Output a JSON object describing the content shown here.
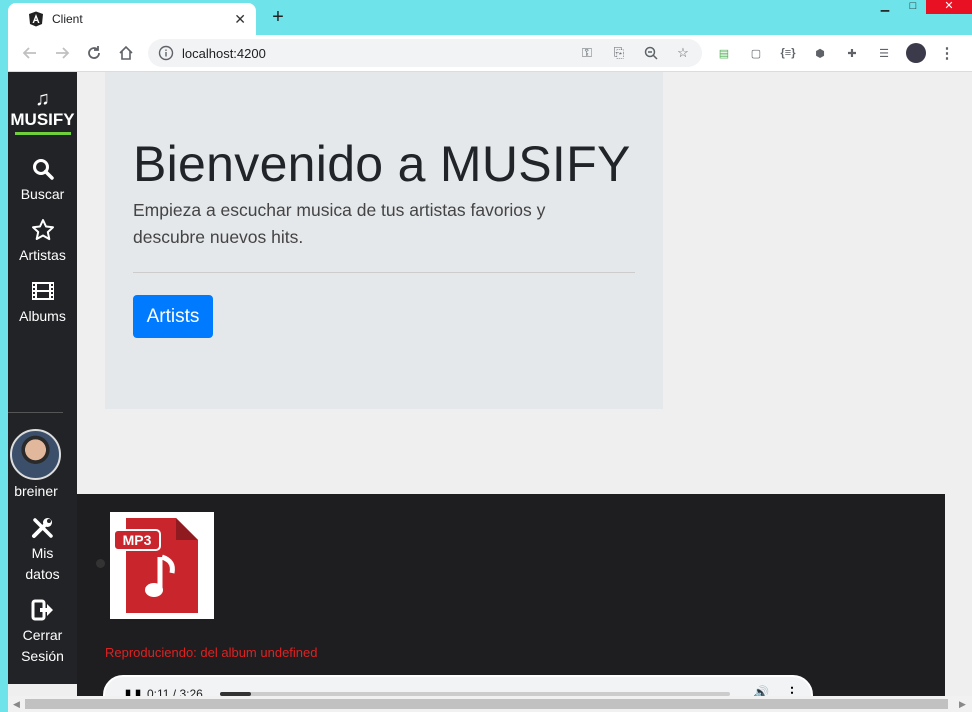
{
  "browser": {
    "tab_title": "Client",
    "url": "localhost:4200",
    "new_tab": "+",
    "audio_icon": "speaker-icon",
    "tab_close": "✕"
  },
  "sidebar": {
    "brand": "MUSIFY",
    "accent_color": "#6fd03b",
    "items": [
      {
        "label": "Buscar",
        "icon": "search-icon"
      },
      {
        "label": "Artistas",
        "icon": "star-icon"
      },
      {
        "label": "Albums",
        "icon": "film-icon"
      }
    ],
    "user": {
      "name": "breiner"
    },
    "user_items": [
      {
        "label_1": "Mis",
        "label_2": "datos",
        "icon": "tools-icon"
      },
      {
        "label_1": "Cerrar",
        "label_2": "Sesión",
        "icon": "sign-out-icon"
      }
    ]
  },
  "jumbotron": {
    "title": "Bienvenido a MUSIFY",
    "lead": "Empieza a escuchar musica de tus artistas favorios y descubre nuevos hits.",
    "button": "Artists",
    "button_color": "#007bff"
  },
  "player": {
    "cover_label": "MP3",
    "now_playing": "Reproduciendo: del album undefined",
    "time": "0:11 / 3:26",
    "progress": 0.06
  }
}
